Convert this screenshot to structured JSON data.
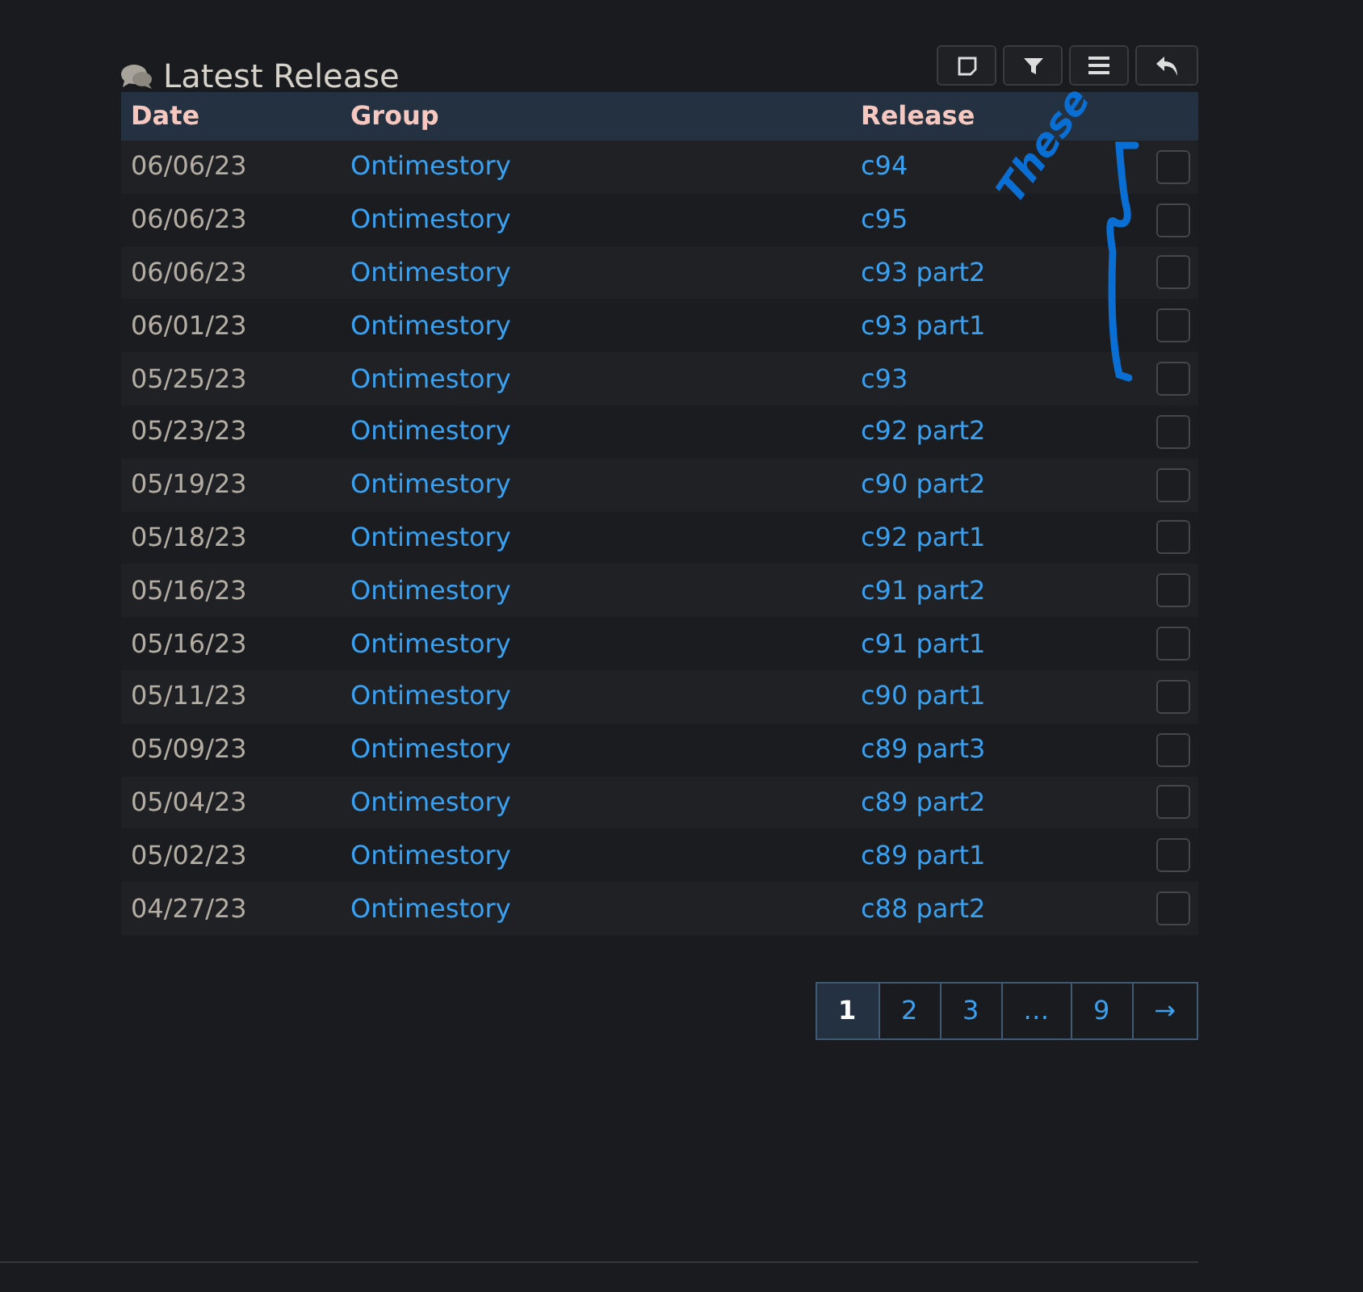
{
  "title": "Latest Release",
  "toolbar": [
    {
      "kind": "note"
    },
    {
      "kind": "filter"
    },
    {
      "kind": "menu"
    },
    {
      "kind": "back"
    }
  ],
  "table": {
    "columns": [
      "Date",
      "Group",
      "Release"
    ],
    "rows": [
      {
        "date": "06/06/23",
        "group": "Ontimestory",
        "release": "c94",
        "checked": false
      },
      {
        "date": "06/06/23",
        "group": "Ontimestory",
        "release": "c95",
        "checked": false
      },
      {
        "date": "06/06/23",
        "group": "Ontimestory",
        "release": "c93 part2",
        "checked": false
      },
      {
        "date": "06/01/23",
        "group": "Ontimestory",
        "release": "c93 part1",
        "checked": false
      },
      {
        "date": "05/25/23",
        "group": "Ontimestory",
        "release": "c93",
        "checked": false
      },
      {
        "date": "05/23/23",
        "group": "Ontimestory",
        "release": "c92 part2",
        "checked": false
      },
      {
        "date": "05/19/23",
        "group": "Ontimestory",
        "release": "c90 part2",
        "checked": false
      },
      {
        "date": "05/18/23",
        "group": "Ontimestory",
        "release": "c92 part1",
        "checked": false
      },
      {
        "date": "05/16/23",
        "group": "Ontimestory",
        "release": "c91 part2",
        "checked": false
      },
      {
        "date": "05/16/23",
        "group": "Ontimestory",
        "release": "c91 part1",
        "checked": false
      },
      {
        "date": "05/11/23",
        "group": "Ontimestory",
        "release": "c90 part1",
        "checked": false
      },
      {
        "date": "05/09/23",
        "group": "Ontimestory",
        "release": "c89 part3",
        "checked": false
      },
      {
        "date": "05/04/23",
        "group": "Ontimestory",
        "release": "c89 part2",
        "checked": false
      },
      {
        "date": "05/02/23",
        "group": "Ontimestory",
        "release": "c89 part1",
        "checked": false
      },
      {
        "date": "04/27/23",
        "group": "Ontimestory",
        "release": "c88 part2",
        "checked": false
      }
    ]
  },
  "pagination": [
    {
      "label": "1",
      "selected": true
    },
    {
      "label": "2",
      "selected": false
    },
    {
      "label": "3",
      "selected": false
    },
    {
      "label": "…",
      "selected": false
    },
    {
      "label": "9",
      "selected": false
    },
    {
      "label": "→",
      "selected": false
    }
  ],
  "annotation": {
    "text": "These"
  }
}
